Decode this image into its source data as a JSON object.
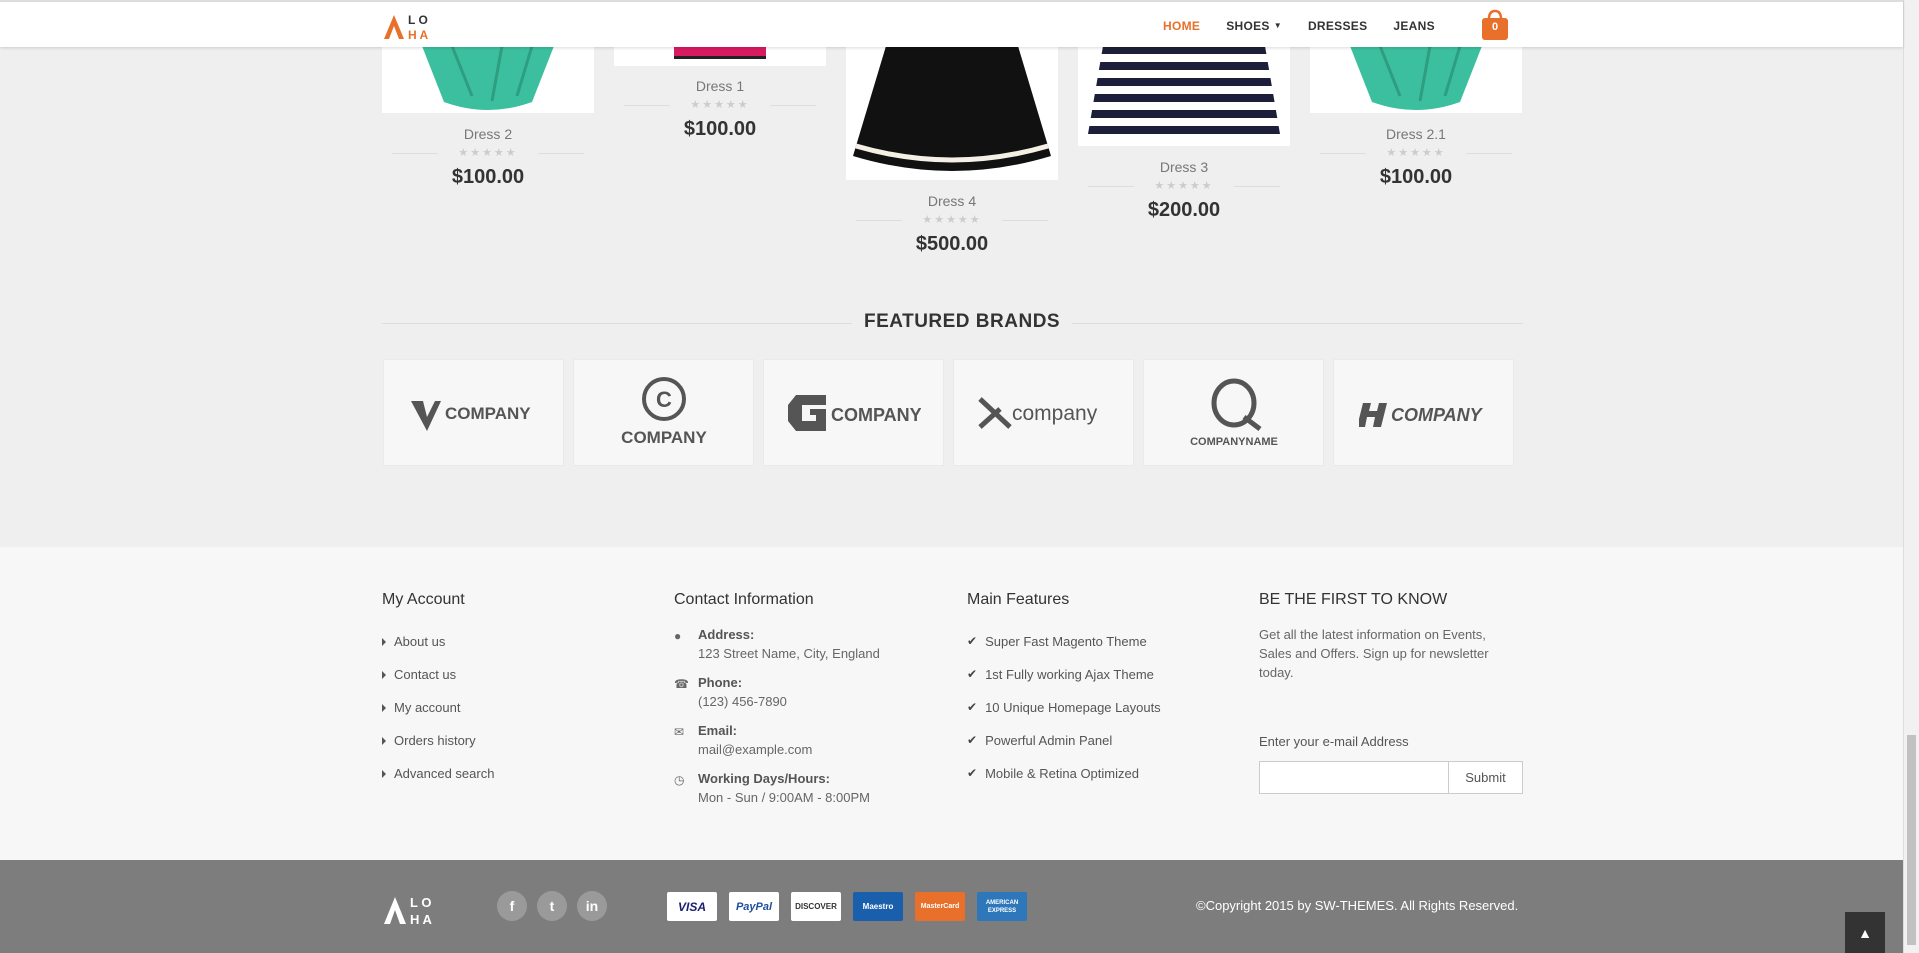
{
  "header": {
    "nav": [
      {
        "label": "HOME",
        "active": true
      },
      {
        "label": "SHOES",
        "dropdown": true
      },
      {
        "label": "DRESSES"
      },
      {
        "label": "JEANS"
      }
    ],
    "cart_count": "0",
    "accent": "#e8702a"
  },
  "products": [
    {
      "name": "Dress 2",
      "price": "$100.00",
      "rating": 0
    },
    {
      "name": "Dress 1",
      "price": "$100.00",
      "rating": 0
    },
    {
      "name": "Dress 4",
      "price": "$500.00",
      "rating": 0
    },
    {
      "name": "Dress 3",
      "price": "$200.00",
      "rating": 0
    },
    {
      "name": "Dress 2.1",
      "price": "$100.00",
      "rating": 0
    }
  ],
  "brands": {
    "title": "FEATURED BRANDS",
    "items": [
      {
        "text": "COMPANY"
      },
      {
        "text": "COMPANY"
      },
      {
        "text": "COMPANY"
      },
      {
        "text": "company"
      },
      {
        "text": "COMPANYNAME"
      },
      {
        "text": "COMPANY"
      }
    ]
  },
  "footer": {
    "my_account": {
      "title": "My Account",
      "links": [
        "About us",
        "Contact us",
        "My account",
        "Orders history",
        "Advanced search"
      ]
    },
    "contact": {
      "title": "Contact Information",
      "items": [
        {
          "label": "Address:",
          "value": "123 Street Name, City, England",
          "icon": "map-pin-icon"
        },
        {
          "label": "Phone:",
          "value": "(123) 456-7890",
          "icon": "phone-icon"
        },
        {
          "label": "Email:",
          "value": "mail@example.com",
          "icon": "envelope-icon"
        },
        {
          "label": "Working Days/Hours:",
          "value": "Mon - Sun / 9:00AM - 8:00PM",
          "icon": "clock-icon"
        }
      ]
    },
    "features": {
      "title": "Main Features",
      "items": [
        "Super Fast Magento Theme",
        "1st Fully working Ajax Theme",
        "10 Unique Homepage Layouts",
        "Powerful Admin Panel",
        "Mobile & Retina Optimized"
      ]
    },
    "newsletter": {
      "title": "BE THE FIRST TO KNOW",
      "text": "Get all the latest information on Events, Sales and Offers. Sign up for newsletter today.",
      "input_label": "Enter your e-mail Address",
      "input_value": "",
      "submit": "Submit"
    }
  },
  "bottom": {
    "social": [
      {
        "label": "f",
        "icon": "facebook-icon"
      },
      {
        "label": "t",
        "icon": "twitter-icon"
      },
      {
        "label": "in",
        "icon": "linkedin-icon"
      }
    ],
    "payments": [
      "VISA",
      "PayPal",
      "DISCOVER",
      "Maestro",
      "MasterCard",
      "AMERICAN EXPRESS"
    ],
    "copyright": "©Copyright 2015 by SW-THEMES. All Rights Reserved."
  }
}
